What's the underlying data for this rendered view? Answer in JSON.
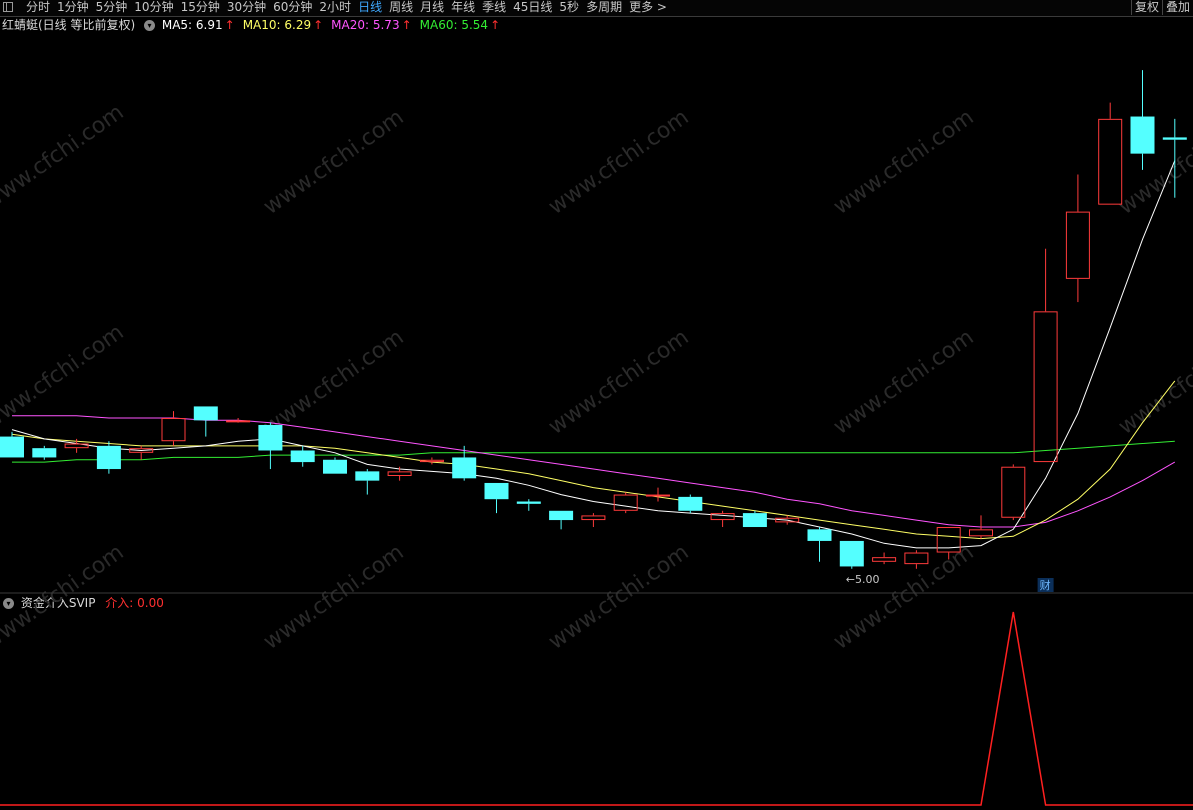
{
  "toolbar": {
    "periods": [
      "分时",
      "1分钟",
      "5分钟",
      "10分钟",
      "15分钟",
      "30分钟",
      "60分钟",
      "2小时",
      "日线",
      "周线",
      "月线",
      "年线",
      "季线",
      "45日线",
      "5秒",
      "多周期",
      "更多 >"
    ],
    "active": "日线",
    "right_buttons": [
      "复权",
      "叠加"
    ]
  },
  "main_chart": {
    "title": "红蜻蜓(日线 等比前复权)",
    "ma": [
      {
        "label": "MA5: 6.91",
        "color": "#ffffff"
      },
      {
        "label": "MA10: 6.29",
        "color": "#ffff66"
      },
      {
        "label": "MA20: 5.73",
        "color": "#ff55ff"
      },
      {
        "label": "MA60: 5.54",
        "color": "#33ee33"
      }
    ],
    "low_marker": "←5.00",
    "cai_badge": "财"
  },
  "indicator": {
    "title": "资金介入SVIP",
    "value_label": "介入: 0.00"
  },
  "watermark": "www.cfchi.com",
  "colors": {
    "up": "#ff3b3b",
    "down": "#54ffff",
    "ma5": "#ffffff",
    "ma10": "#ffff66",
    "ma20": "#ff55ff",
    "ma60": "#33ee33",
    "signal": "#ff2020",
    "active": "#3fa9ff"
  },
  "chart_data": {
    "type": "candlestick",
    "candles": [
      {
        "o": 5.39,
        "c": 5.3,
        "h": 5.41,
        "l": 5.3
      },
      {
        "o": 5.34,
        "c": 5.3,
        "h": 5.35,
        "l": 5.29
      },
      {
        "o": 5.34,
        "c": 5.36,
        "h": 5.38,
        "l": 5.32
      },
      {
        "o": 5.35,
        "c": 5.25,
        "h": 5.37,
        "l": 5.23
      },
      {
        "o": 5.32,
        "c": 5.34,
        "h": 5.35,
        "l": 5.29
      },
      {
        "o": 5.37,
        "c": 5.47,
        "h": 5.5,
        "l": 5.35
      },
      {
        "o": 5.52,
        "c": 5.46,
        "h": 5.52,
        "l": 5.39
      },
      {
        "o": 5.46,
        "c": 5.46,
        "h": 5.47,
        "l": 5.45
      },
      {
        "o": 5.44,
        "c": 5.33,
        "h": 5.45,
        "l": 5.25
      },
      {
        "o": 5.33,
        "c": 5.28,
        "h": 5.35,
        "l": 5.26
      },
      {
        "o": 5.29,
        "c": 5.23,
        "h": 5.3,
        "l": 5.23
      },
      {
        "o": 5.24,
        "c": 5.2,
        "h": 5.25,
        "l": 5.14
      },
      {
        "o": 5.22,
        "c": 5.24,
        "h": 5.26,
        "l": 5.2
      },
      {
        "o": 5.28,
        "c": 5.29,
        "h": 5.3,
        "l": 5.27
      },
      {
        "o": 5.3,
        "c": 5.21,
        "h": 5.35,
        "l": 5.2
      },
      {
        "o": 5.19,
        "c": 5.12,
        "h": 5.19,
        "l": 5.06
      },
      {
        "o": 5.11,
        "c": 5.1,
        "h": 5.12,
        "l": 5.07
      },
      {
        "o": 5.07,
        "c": 5.03,
        "h": 5.07,
        "l": 4.99
      },
      {
        "o": 5.03,
        "c": 5.05,
        "h": 5.06,
        "l": 5.0
      },
      {
        "o": 5.07,
        "c": 5.14,
        "h": 5.15,
        "l": 5.06
      },
      {
        "o": 5.14,
        "c": 5.14,
        "h": 5.17,
        "l": 5.11
      },
      {
        "o": 5.13,
        "c": 5.07,
        "h": 5.14,
        "l": 5.06
      },
      {
        "o": 5.03,
        "c": 5.06,
        "h": 5.07,
        "l": 5.0
      },
      {
        "o": 5.06,
        "c": 5.0,
        "h": 5.07,
        "l": 5.0
      },
      {
        "o": 5.02,
        "c": 5.04,
        "h": 5.05,
        "l": 5.01
      },
      {
        "o": 4.99,
        "c": 4.94,
        "h": 5.0,
        "l": 4.85
      },
      {
        "o": 4.94,
        "c": 4.83,
        "h": 4.94,
        "l": 4.82
      },
      {
        "o": 4.85,
        "c": 4.87,
        "h": 4.89,
        "l": 4.84
      },
      {
        "o": 4.84,
        "c": 4.89,
        "h": 4.9,
        "l": 4.82
      },
      {
        "o": 4.89,
        "c": 5.0,
        "h": 5.0,
        "l": 4.86
      },
      {
        "o": 4.96,
        "c": 4.99,
        "h": 5.05,
        "l": 4.95
      },
      {
        "o": 5.04,
        "c": 5.26,
        "h": 5.27,
        "l": 5.03
      },
      {
        "o": 5.28,
        "c": 5.93,
        "h": 6.2,
        "l": 5.28
      },
      {
        "o": 6.07,
        "c": 6.36,
        "h": 6.52,
        "l": 5.97
      },
      {
        "o": 6.39,
        "c": 6.76,
        "h": 6.83,
        "l": 6.39
      },
      {
        "o": 6.77,
        "c": 6.61,
        "h": 6.97,
        "l": 6.54
      },
      {
        "o": 6.68,
        "c": 6.67,
        "h": 6.76,
        "l": 6.42
      }
    ],
    "ma5": [
      5.42,
      5.38,
      5.36,
      5.34,
      5.33,
      5.34,
      5.35,
      5.37,
      5.38,
      5.35,
      5.32,
      5.27,
      5.25,
      5.24,
      5.23,
      5.21,
      5.18,
      5.14,
      5.11,
      5.09,
      5.07,
      5.06,
      5.05,
      5.04,
      5.03,
      5.0,
      4.97,
      4.93,
      4.91,
      4.91,
      4.92,
      4.99,
      5.21,
      5.49,
      5.86,
      6.24,
      6.58
    ],
    "ma10": [
      5.4,
      5.38,
      5.37,
      5.36,
      5.35,
      5.35,
      5.35,
      5.35,
      5.35,
      5.35,
      5.34,
      5.32,
      5.3,
      5.28,
      5.27,
      5.25,
      5.23,
      5.2,
      5.17,
      5.15,
      5.13,
      5.11,
      5.09,
      5.07,
      5.05,
      5.03,
      5.01,
      4.99,
      4.97,
      4.96,
      4.95,
      4.96,
      5.03,
      5.12,
      5.25,
      5.45,
      5.63
    ],
    "ma20": [
      5.48,
      5.48,
      5.48,
      5.47,
      5.47,
      5.47,
      5.46,
      5.46,
      5.45,
      5.43,
      5.41,
      5.39,
      5.37,
      5.35,
      5.33,
      5.31,
      5.29,
      5.27,
      5.25,
      5.23,
      5.21,
      5.19,
      5.17,
      5.15,
      5.12,
      5.1,
      5.07,
      5.05,
      5.03,
      5.01,
      5.0,
      5.0,
      5.02,
      5.07,
      5.13,
      5.2,
      5.28
    ],
    "ma60": [
      5.28,
      5.28,
      5.29,
      5.29,
      5.29,
      5.3,
      5.3,
      5.3,
      5.31,
      5.31,
      5.31,
      5.31,
      5.31,
      5.32,
      5.32,
      5.32,
      5.32,
      5.32,
      5.32,
      5.32,
      5.32,
      5.32,
      5.32,
      5.32,
      5.32,
      5.32,
      5.32,
      5.32,
      5.32,
      5.32,
      5.32,
      5.32,
      5.33,
      5.34,
      5.35,
      5.36,
      5.37
    ],
    "price_range": [
      4.75,
      7.1
    ],
    "signal": [
      0,
      0,
      0,
      0,
      0,
      0,
      0,
      0,
      0,
      0,
      0,
      0,
      0,
      0,
      0,
      0,
      0,
      0,
      0,
      0,
      0,
      0,
      0,
      0,
      0,
      0,
      0,
      0,
      0,
      0,
      0,
      1,
      0,
      0,
      0,
      0,
      0
    ],
    "signal_range": [
      0,
      1.0
    ]
  }
}
